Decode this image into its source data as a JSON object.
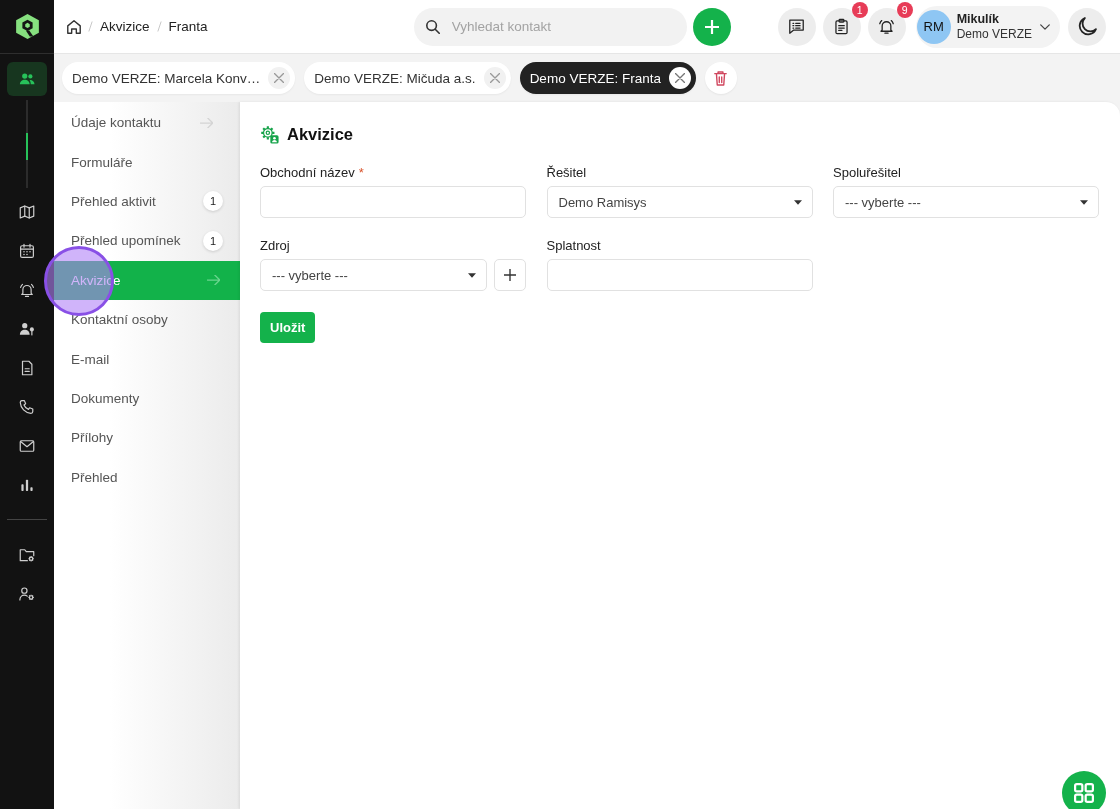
{
  "rail": {
    "pinned": [
      {
        "kind": "contacts",
        "selected": true
      }
    ],
    "items": [
      {
        "kind": "map",
        "selected": false
      },
      {
        "kind": "calendar",
        "selected": false
      },
      {
        "kind": "alarm",
        "selected": false
      },
      {
        "kind": "person_key",
        "selected": false
      },
      {
        "kind": "document",
        "selected": false
      },
      {
        "kind": "phone",
        "selected": false
      },
      {
        "kind": "mail",
        "selected": false
      },
      {
        "kind": "chart",
        "selected": false
      }
    ],
    "bottom": [
      {
        "kind": "folder_gear",
        "selected": false
      },
      {
        "kind": "user_gear",
        "selected": false
      }
    ]
  },
  "breadcrumb": [
    "Akvizice",
    "Franta"
  ],
  "search": {
    "placeholder": "Vyhledat kontakt"
  },
  "header_actions": [
    {
      "kind": "chat"
    },
    {
      "kind": "clipboard",
      "badge": "1"
    },
    {
      "kind": "bell",
      "badge": "9"
    }
  ],
  "user": {
    "initials": "RM",
    "name": "Mikulík",
    "company": "Demo VERZE"
  },
  "tabs": [
    {
      "label": "Demo VERZE: Marcela Konv…",
      "selected": false
    },
    {
      "label": "Demo VERZE: Mičuda a.s.",
      "selected": false
    },
    {
      "label": "Demo VERZE: Franta",
      "selected": true
    }
  ],
  "menu": [
    {
      "label": "Údaje kontaktu",
      "selected": false,
      "arrow": true
    },
    {
      "label": "Formuláře",
      "selected": false,
      "arrow": false
    },
    {
      "label": "Přehled aktivit",
      "selected": false,
      "arrow": false,
      "badge": "1"
    },
    {
      "label": "Přehled upomínek",
      "selected": false,
      "arrow": false,
      "badge": "1"
    },
    {
      "label": "Akvizice",
      "selected": true,
      "arrow": true
    },
    {
      "label": "Kontaktní osoby",
      "selected": false,
      "arrow": false
    },
    {
      "label": "E-mail",
      "selected": false,
      "arrow": false
    },
    {
      "label": "Dokumenty",
      "selected": false,
      "arrow": false
    },
    {
      "label": "Přílohy",
      "selected": false,
      "arrow": false
    },
    {
      "label": "Přehled",
      "selected": false,
      "arrow": false
    }
  ],
  "form": {
    "title": "Akvizice",
    "fields": [
      {
        "kind": "text",
        "label": "Obchodní název",
        "required_mark": "*"
      },
      {
        "kind": "select",
        "label": "Řešitel",
        "value": "Demo Ramisys"
      },
      {
        "kind": "select",
        "label": "Spoluřešitel",
        "value": "--- vyberte ---"
      },
      {
        "kind": "select_add",
        "label": "Zdroj",
        "value": "--- vyberte ---"
      },
      {
        "kind": "text",
        "label": "Splatnost"
      }
    ],
    "submit": "Uložit"
  }
}
